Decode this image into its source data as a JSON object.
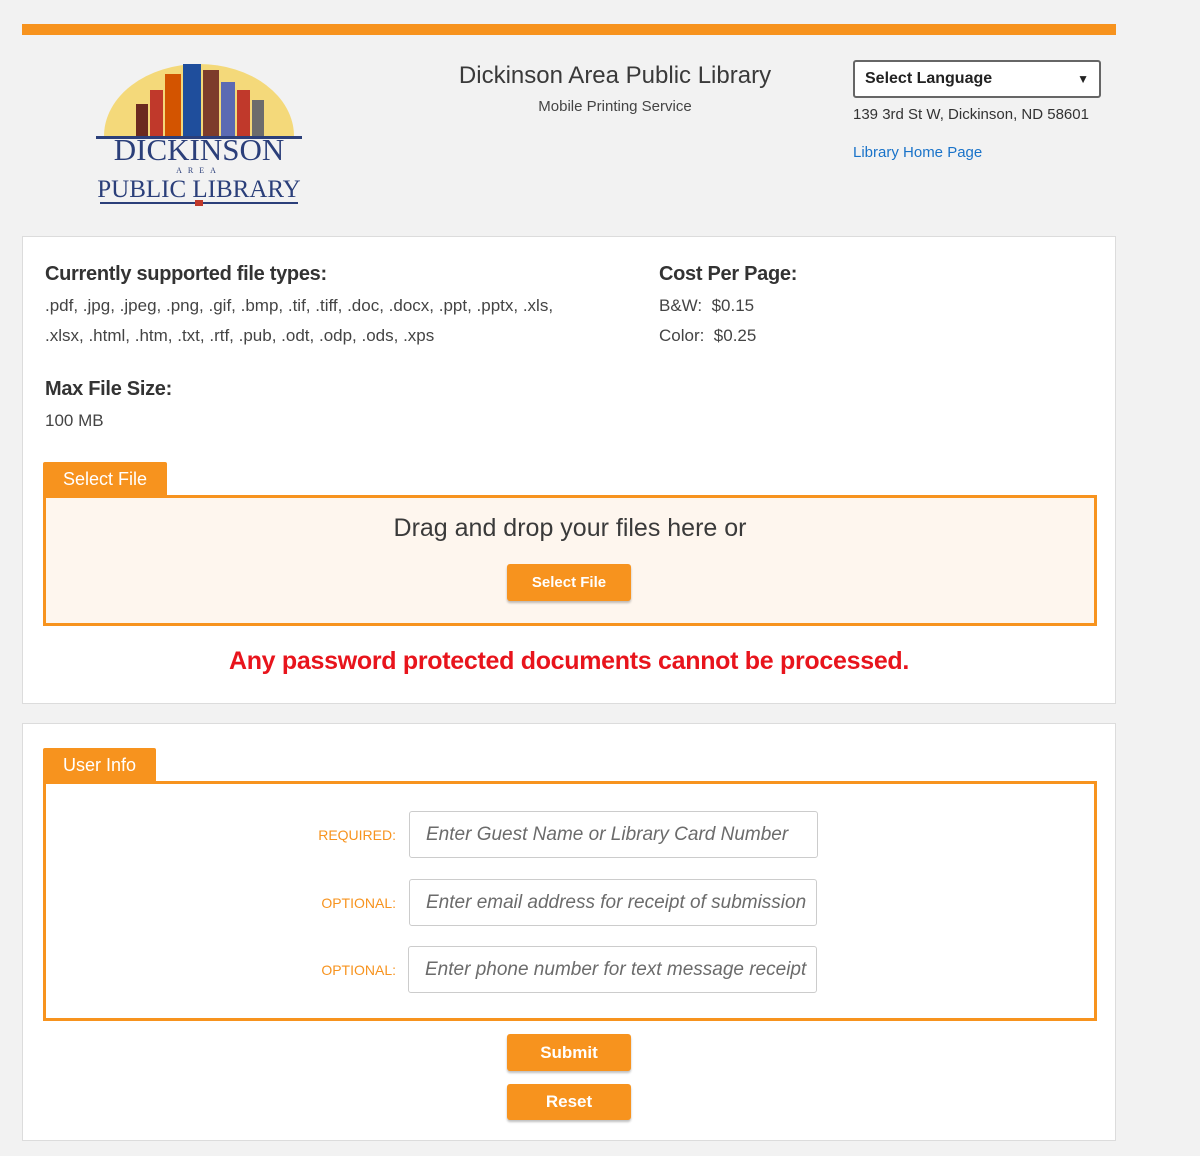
{
  "header": {
    "library_name": "Dickinson Area Public Library",
    "service_name": "Mobile Printing Service",
    "logo_line1": "DICKINSON",
    "logo_line2": "AREA",
    "logo_line3": "PUBLIC LIBRARY",
    "language_select": "Select Language",
    "address": "139 3rd St W, Dickinson, ND 58601",
    "home_link": "Library Home Page"
  },
  "info": {
    "file_types_heading": "Currently supported file types:",
    "file_types_line1": ".pdf, .jpg, .jpeg, .png, .gif, .bmp, .tif, .tiff, .doc, .docx, .ppt, .pptx, .xls,",
    "file_types_line2": ".xlsx, .html, .htm, .txt, .rtf, .pub, .odt, .odp, .ods, .xps",
    "cost_heading": "Cost Per Page:",
    "cost_bw": "B&W:  $0.15",
    "cost_color": "Color:  $0.25",
    "max_size_heading": "Max File Size:",
    "max_size_value": "100 MB"
  },
  "upload": {
    "tab_label": "Select File",
    "drop_text": "Drag and drop your files here or",
    "select_button": "Select File",
    "warning": "Any password protected documents cannot be processed."
  },
  "user_info": {
    "tab_label": "User Info",
    "fields": [
      {
        "label": "REQUIRED:",
        "placeholder": "Enter Guest Name or Library Card Number"
      },
      {
        "label": "OPTIONAL:",
        "placeholder": "Enter email address for receipt of submission"
      },
      {
        "label": "OPTIONAL:",
        "placeholder": "Enter phone number for text message receipt"
      }
    ],
    "submit_button": "Submit",
    "reset_button": "Reset"
  },
  "colors": {
    "accent": "#f7931e",
    "warning": "#e8141c",
    "link": "#1a73c9"
  }
}
